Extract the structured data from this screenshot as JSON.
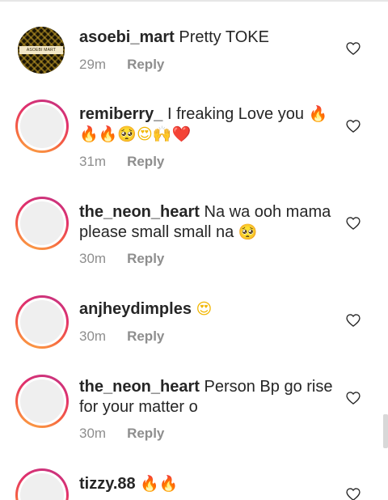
{
  "comments": [
    {
      "username": "asoebi_mart",
      "text": "Pretty TOKE",
      "time": "29m",
      "reply_label": "Reply",
      "avatar": "asoebi-mart-logo",
      "avatar_text": "ASOEBI MART"
    },
    {
      "username": "remiberry_",
      "text": "I freaking Love you",
      "emojis": [
        "🔥",
        "🔥",
        "🔥",
        "🥺",
        "😍",
        "🙌",
        "❤️"
      ],
      "time": "31m",
      "reply_label": "Reply"
    },
    {
      "username": "the_neon_heart",
      "text": "Na wa ooh mama please small small na",
      "emojis": [
        "🥺"
      ],
      "time": "30m",
      "reply_label": "Reply"
    },
    {
      "username": "anjheydimples",
      "text": "",
      "emojis": [
        "😍"
      ],
      "time": "30m",
      "reply_label": "Reply"
    },
    {
      "username": "the_neon_heart",
      "text": "Person Bp go rise for your matter o",
      "time": "30m",
      "reply_label": "Reply"
    },
    {
      "username": "tizzy.88",
      "text": "",
      "emojis": [
        "🔥",
        "🔥"
      ]
    }
  ],
  "icons": {
    "like": "heart-outline-icon"
  },
  "colors": {
    "text": "#262626",
    "meta": "#8e8e8e",
    "story_ring": [
      "#c13584",
      "#e1306c",
      "#f56040",
      "#fcaf45"
    ]
  }
}
